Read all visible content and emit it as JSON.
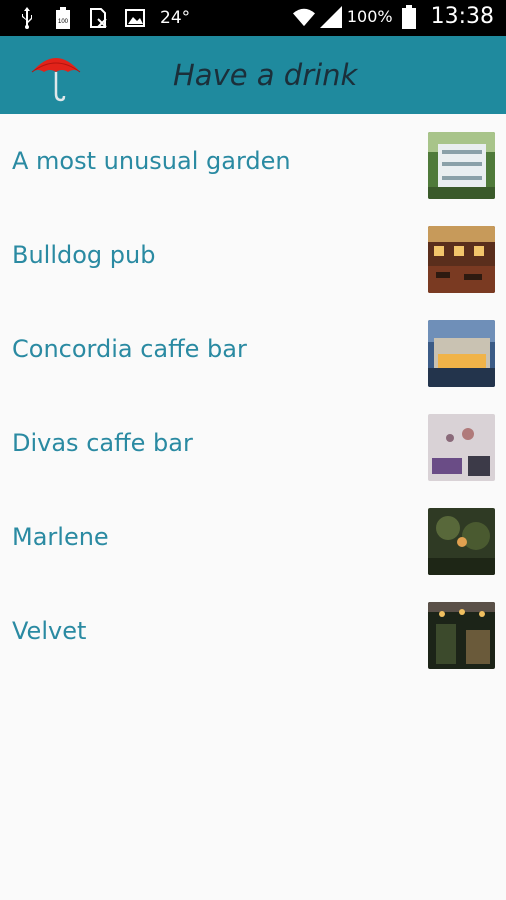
{
  "status_bar": {
    "temperature": "24°",
    "battery_percent": "100%",
    "time": "13:38",
    "icons": [
      "usb-icon",
      "battery-100-icon",
      "sim-icon",
      "image-icon",
      "wifi-icon",
      "signal-icon",
      "battery-icon"
    ]
  },
  "toolbar": {
    "title": "Have a drink",
    "logo_icon": "umbrella-icon"
  },
  "list": {
    "items": [
      {
        "label": "A most unusual garden"
      },
      {
        "label": "Bulldog pub"
      },
      {
        "label": "Concordia caffe bar"
      },
      {
        "label": "Divas caffe bar"
      },
      {
        "label": "Marlene"
      },
      {
        "label": "Velvet"
      }
    ]
  },
  "colors": {
    "toolbar": "#1f8a9e",
    "item_text": "#2a8aa2",
    "title_text": "#1b2f3a",
    "umbrella": "#e2231a"
  }
}
